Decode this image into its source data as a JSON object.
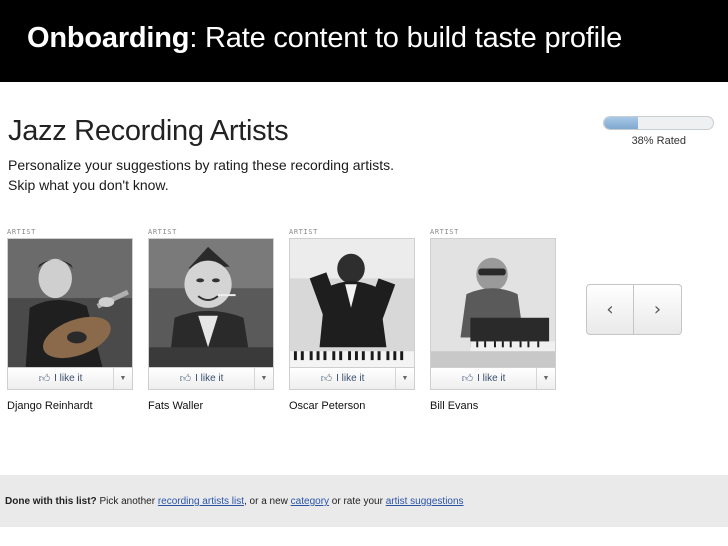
{
  "banner": {
    "title_bold": "Onboarding",
    "title_rest": ": Rate content to build taste profile"
  },
  "page": {
    "title": "Jazz Recording Artists",
    "subtitle_line1": "Personalize your suggestions by rating these recording artists.",
    "subtitle_line2": "Skip what you don't know."
  },
  "progress": {
    "label": "38% Rated",
    "fraction": 0.31
  },
  "cards": [
    {
      "tag": "ARTIST",
      "name": "Django Reinhardt",
      "like_label": "I like it",
      "thumb_icon": "thumbs-up-icon",
      "caret_icon": "caret-down-icon"
    },
    {
      "tag": "ARTIST",
      "name": "Fats Waller",
      "like_label": "I like it",
      "thumb_icon": "thumbs-up-icon",
      "caret_icon": "caret-down-icon"
    },
    {
      "tag": "ARTIST",
      "name": "Oscar Peterson",
      "like_label": "I like it",
      "thumb_icon": "thumbs-up-icon",
      "caret_icon": "caret-down-icon"
    },
    {
      "tag": "ARTIST",
      "name": "Bill Evans",
      "like_label": "I like it",
      "thumb_icon": "thumbs-up-icon",
      "caret_icon": "caret-down-icon"
    }
  ],
  "nav": {
    "prev_icon": "chevron-left-icon",
    "next_icon": "chevron-right-icon"
  },
  "footer": {
    "lead": "Done with this list?",
    "text1": " Pick another ",
    "link1": "recording artists list",
    "text2": ", or a new ",
    "link2": "category",
    "text3": " or rate your ",
    "link3": "artist suggestions"
  },
  "colors": {
    "banner_bg": "#000000",
    "link": "#2a54a8",
    "progress_fill": "#7fa8d0",
    "footer_bg": "#eaeaea"
  }
}
